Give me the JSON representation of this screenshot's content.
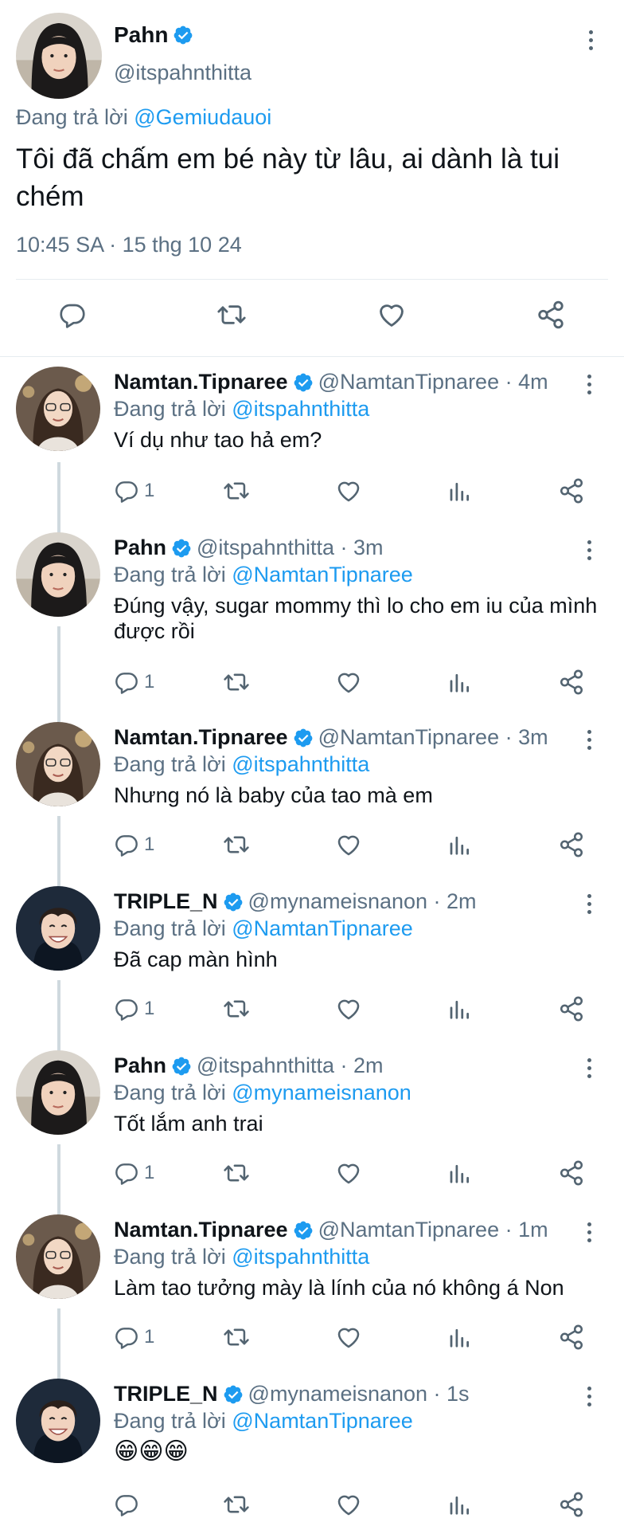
{
  "main_tweet": {
    "author_name": "Pahn",
    "author_handle": "@itspahnthitta",
    "replying_prefix": "Đang trả lời ",
    "replying_to": "@Gemiudauoi",
    "text": "Tôi đã chấm em bé này từ lâu, ai dành là tui chém",
    "timestamp": "10:45 SA · 15 thg 10 24"
  },
  "replies": [
    {
      "name": "Namtan.Tipnaree",
      "handle_time": "@NamtanTipnaree · 4m",
      "replying_prefix": "Đang trả lời ",
      "replying_to": "@itspahnthitta",
      "text": "Ví dụ như tao hả em?",
      "reply_count": "1",
      "avatar": "namtan"
    },
    {
      "name": "Pahn",
      "handle_time": "@itspahnthitta · 3m",
      "replying_prefix": "Đang trả lời ",
      "replying_to": "@NamtanTipnaree",
      "text": "Đúng vậy, sugar mommy thì lo cho em iu của mình được rồi",
      "reply_count": "1",
      "avatar": "pahn"
    },
    {
      "name": "Namtan.Tipnaree",
      "handle_time": "@NamtanTipnaree · 3m",
      "replying_prefix": "Đang trả lời ",
      "replying_to": "@itspahnthitta",
      "text": "Nhưng nó là baby của tao mà em",
      "reply_count": "1",
      "avatar": "namtan"
    },
    {
      "name": "TRIPLE_N",
      "handle_time": "@mynameisnanon · 2m",
      "replying_prefix": "Đang trả lời ",
      "replying_to": "@NamtanTipnaree",
      "text": "Đã cap màn hình",
      "reply_count": "1",
      "avatar": "nanon"
    },
    {
      "name": "Pahn",
      "handle_time": "@itspahnthitta · 2m",
      "replying_prefix": "Đang trả lời ",
      "replying_to": "@mynameisnanon",
      "text": "Tốt lắm anh trai",
      "reply_count": "1",
      "avatar": "pahn"
    },
    {
      "name": "Namtan.Tipnaree",
      "handle_time": "@NamtanTipnaree · 1m",
      "replying_prefix": "Đang trả lời ",
      "replying_to": "@itspahnthitta",
      "text": "Làm tao tưởng mày là lính của nó không á Non",
      "reply_count": "1",
      "avatar": "namtan"
    },
    {
      "name": "TRIPLE_N",
      "handle_time": "@mynameisnanon · 1s",
      "replying_prefix": "Đang trả lời ",
      "replying_to": "@NamtanTipnaree",
      "text": "😁😁😁",
      "reply_count": "",
      "avatar": "nanon"
    }
  ],
  "icons": {
    "verified": "verified-badge-icon",
    "more": "more-options-icon",
    "reply": "reply-icon",
    "retweet": "retweet-icon",
    "like": "like-icon",
    "analytics": "analytics-icon",
    "share": "share-icon"
  },
  "colors": {
    "accent": "#1d9bf0",
    "secondary_text": "#5b7083",
    "thread_line": "#cfd9de"
  }
}
